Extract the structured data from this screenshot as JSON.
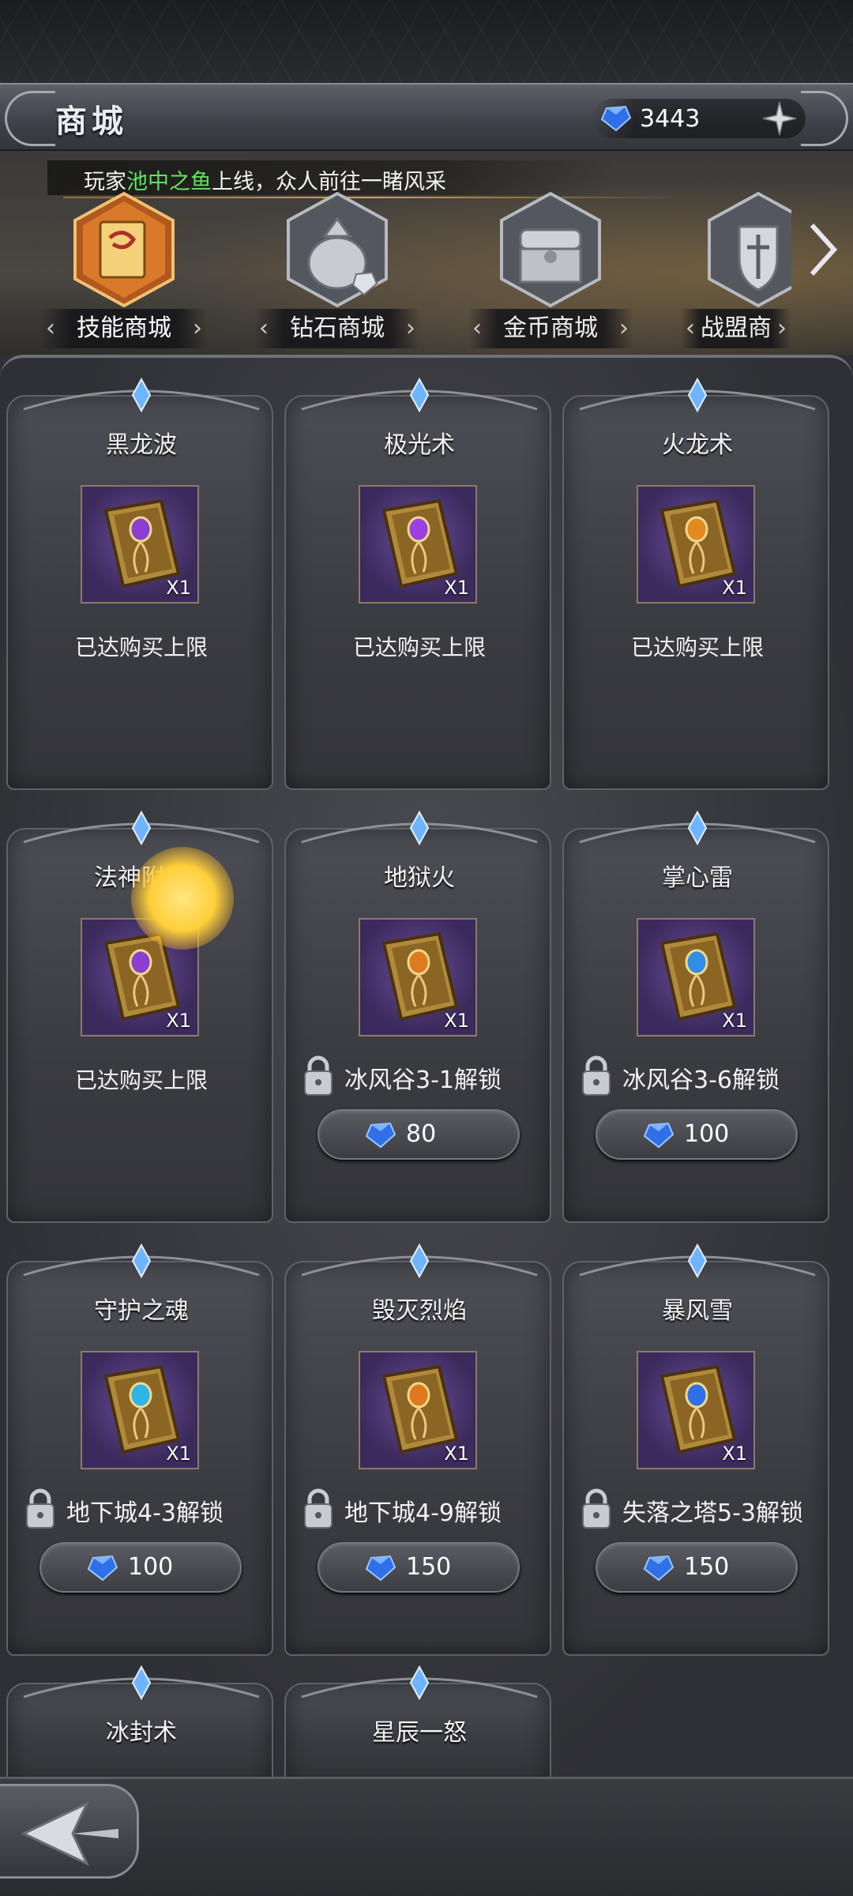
{
  "header": {
    "title": "商城",
    "diamond_amount": "3443"
  },
  "notice": {
    "prefix": "玩家",
    "player": "池中之鱼",
    "suffix": "上线，众人前往一睹风采"
  },
  "tabs": [
    {
      "label": "技能商城",
      "icon": "skill-book-icon",
      "active": true
    },
    {
      "label": "钻石商城",
      "icon": "diamond-bag-icon",
      "active": false
    },
    {
      "label": "金币商城",
      "icon": "treasure-chest-icon",
      "active": false
    },
    {
      "label": "战盟商",
      "icon": "guild-crest-icon",
      "active": false
    }
  ],
  "items": [
    {
      "name": "黑龙波",
      "qty": "X1",
      "status": "已达购买上限",
      "gem_color": "#8a3fd0"
    },
    {
      "name": "极光术",
      "qty": "X1",
      "status": "已达购买上限",
      "gem_color": "#9b3fe0"
    },
    {
      "name": "火龙术",
      "qty": "X1",
      "status": "已达购买上限",
      "gem_color": "#e08a1f"
    },
    {
      "name": "法神附体",
      "qty": "X1",
      "status": "已达购买上限",
      "gem_color": "#8a3fd0"
    },
    {
      "name": "地狱火",
      "qty": "X1",
      "unlock": "冰风谷3-1解锁",
      "price": "80",
      "gem_color": "#e07a1f"
    },
    {
      "name": "掌心雷",
      "qty": "X1",
      "unlock": "冰风谷3-6解锁",
      "price": "100",
      "gem_color": "#2f8ee8"
    },
    {
      "name": "守护之魂",
      "qty": "X1",
      "unlock": "地下城4-3解锁",
      "price": "100",
      "gem_color": "#2fb4e8"
    },
    {
      "name": "毁灭烈焰",
      "qty": "X1",
      "unlock": "地下城4-9解锁",
      "price": "150",
      "gem_color": "#e0781f"
    },
    {
      "name": "暴风雪",
      "qty": "X1",
      "unlock": "失落之塔5-3解锁",
      "price": "150",
      "gem_color": "#2f6fe8"
    },
    {
      "name": "冰封术"
    },
    {
      "name": "星辰一怒"
    }
  ],
  "colors": {
    "accent_green": "#62e35f",
    "diamond_blue": "#2f6fe8"
  }
}
